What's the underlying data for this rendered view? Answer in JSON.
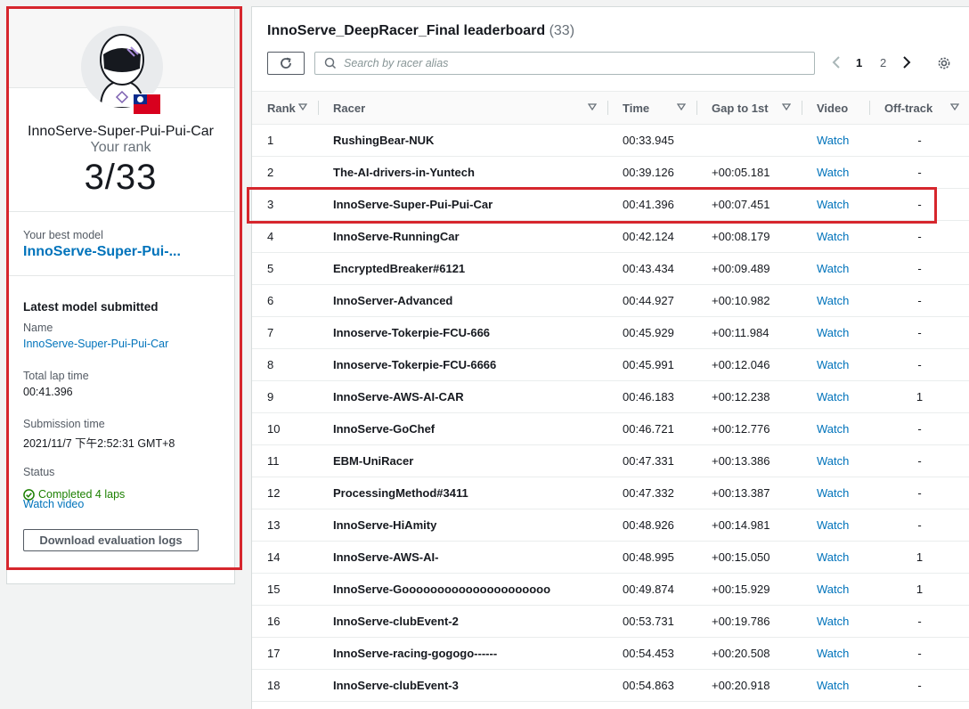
{
  "profile": {
    "racer_name": "InnoServe-Super-Pui-Pui-Car",
    "your_rank_label": "Your rank",
    "rank_value": "3/33",
    "best_model_label": "Your best model",
    "best_model_value": "InnoServe-Super-Pui-...",
    "latest_title": "Latest model submitted",
    "name_label": "Name",
    "name_value": "InnoServe-Super-Pui-Pui-Car",
    "lap_label": "Total lap time",
    "lap_value": "00:41.396",
    "submission_label": "Submission time",
    "submission_value": "2021/11/7 下午2:52:31 GMT+8",
    "status_label": "Status",
    "status_value": "Completed 4 laps",
    "watch_video": "Watch video",
    "download_button": "Download evaluation logs",
    "avatar_icon": "racer-helmet-icon",
    "flag_icon": "taiwan-flag-icon"
  },
  "leaderboard": {
    "title": "InnoServe_DeepRacer_Final leaderboard",
    "count": "(33)",
    "search_placeholder": "Search by racer alias",
    "pages": [
      "1",
      "2"
    ],
    "current_page": "1",
    "columns": {
      "rank": "Rank",
      "racer": "Racer",
      "time": "Time",
      "gap": "Gap to 1st",
      "video": "Video",
      "offtrack": "Off-track"
    },
    "rows": [
      {
        "rank": "1",
        "racer": "RushingBear-NUK",
        "time": "00:33.945",
        "gap": "",
        "video": "Watch",
        "offtrack": "-"
      },
      {
        "rank": "2",
        "racer": "The-AI-drivers-in-Yuntech",
        "time": "00:39.126",
        "gap": "+00:05.181",
        "video": "Watch",
        "offtrack": "-"
      },
      {
        "rank": "3",
        "racer": "InnoServe-Super-Pui-Pui-Car",
        "time": "00:41.396",
        "gap": "+00:07.451",
        "video": "Watch",
        "offtrack": "-"
      },
      {
        "rank": "4",
        "racer": "InnoServe-RunningCar",
        "time": "00:42.124",
        "gap": "+00:08.179",
        "video": "Watch",
        "offtrack": "-"
      },
      {
        "rank": "5",
        "racer": "EncryptedBreaker#6121",
        "time": "00:43.434",
        "gap": "+00:09.489",
        "video": "Watch",
        "offtrack": "-"
      },
      {
        "rank": "6",
        "racer": "InnoServer-Advanced",
        "time": "00:44.927",
        "gap": "+00:10.982",
        "video": "Watch",
        "offtrack": "-"
      },
      {
        "rank": "7",
        "racer": "Innoserve-Tokerpie-FCU-666",
        "time": "00:45.929",
        "gap": "+00:11.984",
        "video": "Watch",
        "offtrack": "-"
      },
      {
        "rank": "8",
        "racer": "Innoserve-Tokerpie-FCU-6666",
        "time": "00:45.991",
        "gap": "+00:12.046",
        "video": "Watch",
        "offtrack": "-"
      },
      {
        "rank": "9",
        "racer": "InnoServe-AWS-AI-CAR",
        "time": "00:46.183",
        "gap": "+00:12.238",
        "video": "Watch",
        "offtrack": "1"
      },
      {
        "rank": "10",
        "racer": "InnoServe-GoChef",
        "time": "00:46.721",
        "gap": "+00:12.776",
        "video": "Watch",
        "offtrack": "-"
      },
      {
        "rank": "11",
        "racer": "EBM-UniRacer",
        "time": "00:47.331",
        "gap": "+00:13.386",
        "video": "Watch",
        "offtrack": "-"
      },
      {
        "rank": "12",
        "racer": "ProcessingMethod#3411",
        "time": "00:47.332",
        "gap": "+00:13.387",
        "video": "Watch",
        "offtrack": "-"
      },
      {
        "rank": "13",
        "racer": "InnoServe-HiAmity",
        "time": "00:48.926",
        "gap": "+00:14.981",
        "video": "Watch",
        "offtrack": "-"
      },
      {
        "rank": "14",
        "racer": "InnoServe-AWS-AI-",
        "time": "00:48.995",
        "gap": "+00:15.050",
        "video": "Watch",
        "offtrack": "1"
      },
      {
        "rank": "15",
        "racer": "InnoServe-Gooooooooooooooooooooo",
        "time": "00:49.874",
        "gap": "+00:15.929",
        "video": "Watch",
        "offtrack": "1"
      },
      {
        "rank": "16",
        "racer": "InnoServe-clubEvent-2",
        "time": "00:53.731",
        "gap": "+00:19.786",
        "video": "Watch",
        "offtrack": "-"
      },
      {
        "rank": "17",
        "racer": "InnoServe-racing-gogogo------",
        "time": "00:54.453",
        "gap": "+00:20.508",
        "video": "Watch",
        "offtrack": "-"
      },
      {
        "rank": "18",
        "racer": "InnoServe-clubEvent-3",
        "time": "00:54.863",
        "gap": "+00:20.918",
        "video": "Watch",
        "offtrack": "-"
      }
    ]
  },
  "colors": {
    "link": "#0073bb",
    "highlight": "#d6262d",
    "success": "#1d8102"
  }
}
